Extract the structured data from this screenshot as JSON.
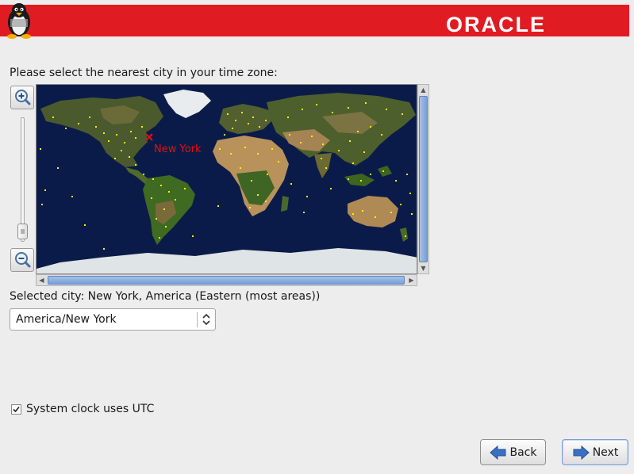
{
  "header": {
    "brand_text": "ORACLE",
    "brand_color": "#e11b22",
    "logo_icon": "tux-penguin-icon"
  },
  "timezone": {
    "prompt": "Please select the nearest city in your time zone:",
    "map_marker_label": "New York",
    "selected_city_text": "Selected city: New York, America (Eastern (most areas))",
    "timezone_select": {
      "value": "America/New York"
    }
  },
  "clock": {
    "utc_label": "System clock uses UTC",
    "utc_checked": true
  },
  "nav": {
    "back_label": "Back",
    "next_label": "Next"
  },
  "colors": {
    "map_ocean": "#0b1b49",
    "city_dot": "#f4f400",
    "selected_marker": "#e01010",
    "scroll_thumb": "#7a9fd6"
  }
}
